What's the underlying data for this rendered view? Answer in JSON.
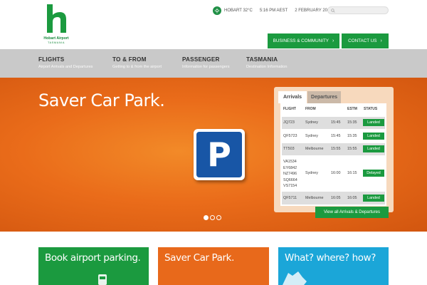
{
  "logo": {
    "name": "Hobart Airport",
    "region": "TASMANIA"
  },
  "meta": {
    "weather": "HOBART 32°C",
    "time": "5:16 PM AEST",
    "date": "2 FEBRUARY 2016",
    "weather_icon": "sun-icon"
  },
  "search": {
    "placeholder": ""
  },
  "top_buttons": {
    "business": "BUSINESS & COMMUNITY",
    "contact": "CONTACT US"
  },
  "nav": [
    {
      "title": "FLIGHTS",
      "desc": "Airport Arrivals and Departures"
    },
    {
      "title": "TO & FROM",
      "desc": "Getting to & from the airport"
    },
    {
      "title": "PASSENGER",
      "desc": "Information for passengers"
    },
    {
      "title": "TASMANIA",
      "desc": "Destination Information"
    }
  ],
  "hero": {
    "title": "Saver Car Park.",
    "sign_letter": "P",
    "slides": 3,
    "active_slide": 1
  },
  "flights": {
    "tabs": [
      "Arrivals",
      "Departures"
    ],
    "active_tab": "Arrivals",
    "columns": [
      "FLIGHT",
      "FROM",
      "ESTM",
      "STATUS"
    ],
    "rows": [
      {
        "flight": "JQ723",
        "from": "Sydney",
        "sched": "15:45",
        "estm": "15:35",
        "status": "Landed"
      },
      {
        "flight": "QF5723",
        "from": "Sydney",
        "sched": "15:45",
        "estm": "15:35",
        "status": "Landed"
      },
      {
        "flight": "TT503",
        "from": "Melbourne",
        "sched": "15:55",
        "estm": "15:55",
        "status": "Landed"
      },
      {
        "flight": "VA1534\nEY6842\nNZ7496\nSQ6664\nVS7154",
        "from": "Sydney",
        "sched": "16:00",
        "estm": "16:15",
        "status": "Delayed"
      },
      {
        "flight": "QF5711",
        "from": "Melbourne",
        "sched": "16:05",
        "estm": "16:05",
        "status": "Landed"
      }
    ],
    "view_all": "View all Arrivals & Departures"
  },
  "cards": {
    "parking": "Book airport parking.",
    "saver": "Saver Car Park.",
    "what": "What? where? how?"
  },
  "colors": {
    "green": "#1b9a3f",
    "orange": "#e8691b",
    "blue": "#1ba6d8",
    "nav_grey": "#c9c9c9"
  }
}
